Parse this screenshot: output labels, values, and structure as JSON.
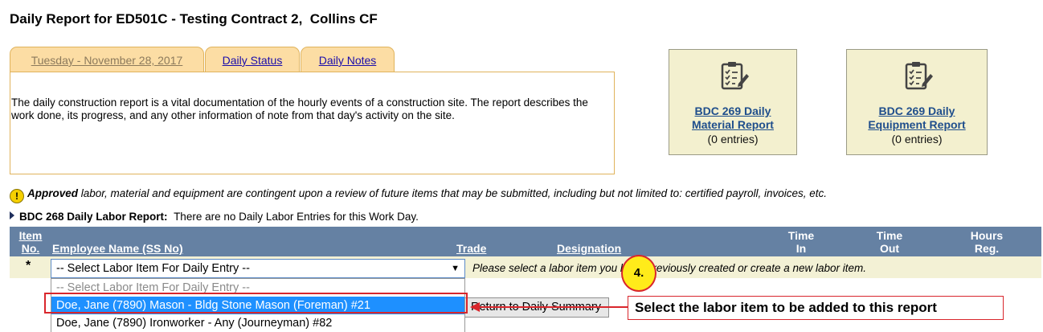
{
  "page": {
    "title": "Daily Report for ED501C - Testing Contract 2,  Collins CF"
  },
  "tabs": [
    {
      "label": "Tuesday - November 28, 2017",
      "active": true
    },
    {
      "label": "Daily Status",
      "active": false
    },
    {
      "label": "Daily Notes",
      "active": false
    }
  ],
  "notes": {
    "text": "The daily construction report is a vital documentation of the hourly events of a construction site. The report describes the work done, its progress, and any other information of note from that day's activity on the site."
  },
  "cards": [
    {
      "title_line1": "BDC 269 Daily",
      "title_line2": "Material Report",
      "count": "(0 entries)",
      "icon": "clipboard-checklist-icon"
    },
    {
      "title_line1": "BDC 269 Daily",
      "title_line2": "Equipment Report",
      "count": "(0 entries)",
      "icon": "clipboard-checklist-icon"
    }
  ],
  "notice": {
    "icon": "warning-icon",
    "strong": "Approved",
    "text": " labor, material and equipment are contingent upon a review of future items that may be submitted, including but not limited to:  certified payroll, invoices, etc."
  },
  "labor": {
    "heading": "BDC 268 Daily Labor Report:",
    "message": "There are no Daily Labor Entries for this Work Day."
  },
  "table": {
    "headers": {
      "item_1": "Item",
      "item_2": "No.",
      "employee": "Employee Name (SS No)",
      "trade": "Trade",
      "designation": "Designation",
      "time_in_1": "Time",
      "time_in_2": "In",
      "time_out_1": "Time",
      "time_out_2": "Out",
      "hours_1": "Hours",
      "hours_2": "Reg."
    },
    "row_marker": "*",
    "select_value": "-- Select Labor Item For Daily Entry --",
    "hint": "Please select a labor item you have previously created or create a new labor item."
  },
  "dropdown": {
    "options": [
      "-- Select Labor Item For Daily Entry --",
      "Doe, Jane (7890) Mason - Bldg Stone Mason (Foreman) #21",
      "Doe, Jane (7890) Ironworker - Any (Journeyman) #82"
    ],
    "selected_index": 1
  },
  "buttons": {
    "return": "Return to Daily Summary"
  },
  "annotation": {
    "step": "4.",
    "text": "Select the labor item to be added to this report"
  },
  "colors": {
    "tab_bg": "#fcdda4",
    "header_bg": "#6581a3",
    "card_bg": "#f3f0cf",
    "highlight": "#d9262c",
    "selected_option": "#1e90ff"
  }
}
